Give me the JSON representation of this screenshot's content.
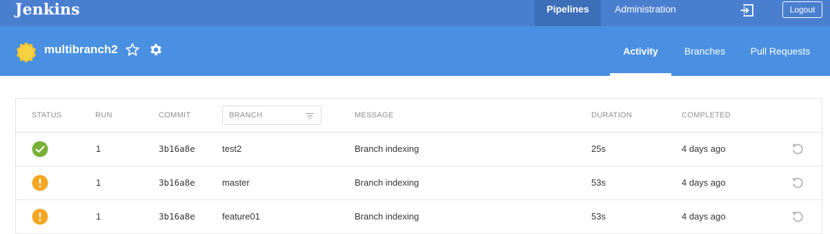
{
  "app": {
    "logo": "Jenkins",
    "nav": {
      "pipelines": "Pipelines",
      "administration": "Administration"
    },
    "logout_label": "Logout",
    "icons": {
      "logout": "logout-icon"
    }
  },
  "project": {
    "name": "multibranch2",
    "weather": "sunny-weather-icon",
    "tabs": {
      "activity": "Activity",
      "branches": "Branches",
      "pull_requests": "Pull Requests"
    },
    "active_tab": "Activity"
  },
  "table": {
    "headers": {
      "status": "STATUS",
      "run": "RUN",
      "commit": "COMMIT",
      "branch": "BRANCH",
      "message": "MESSAGE",
      "duration": "DURATION",
      "completed": "COMPLETED"
    },
    "rows": [
      {
        "status": "success",
        "run": "1",
        "commit": "3b16a8e",
        "branch": "test2",
        "message": "Branch indexing",
        "duration": "25s",
        "completed": "4 days ago"
      },
      {
        "status": "unstable",
        "run": "1",
        "commit": "3b16a8e",
        "branch": "master",
        "message": "Branch indexing",
        "duration": "53s",
        "completed": "4 days ago"
      },
      {
        "status": "unstable",
        "run": "1",
        "commit": "3b16a8e",
        "branch": "feature01",
        "message": "Branch indexing",
        "duration": "53s",
        "completed": "4 days ago"
      }
    ]
  },
  "colors": {
    "topbar": "#4a7fd0",
    "header": "#4a90e2",
    "success": "#78b037",
    "unstable": "#f5a623",
    "sun": "#f7d342"
  }
}
